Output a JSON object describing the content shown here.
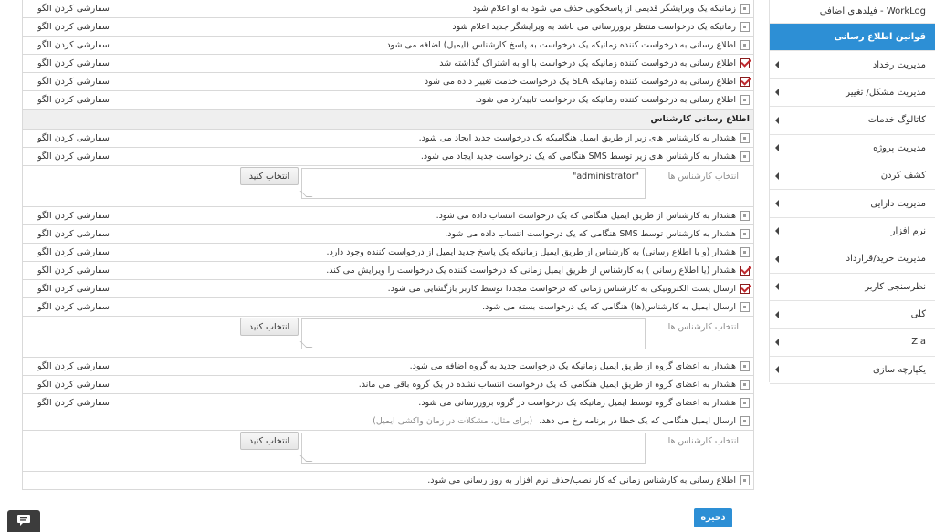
{
  "template_label": "سفارشی کردن الگو",
  "rows_top": [
    {
      "label": "زمانیکه یک ویرایشگر قدیمی از پاسخگویی حذف می شود به او اعلام شود",
      "checked": false
    },
    {
      "label": "زمانیکه یک درخواست منتظر بروزرسانی می باشد به ویرایشگر جدید اعلام شود",
      "checked": false
    },
    {
      "label": "اطلاع رسانی به درخواست کننده زمانیکه یک درخواست به پاسخ کارشناس (ایمیل) اضافه می شود",
      "checked": false
    },
    {
      "label": "اطلاع رسانی به درخواست کننده زمانیکه یک درخواست با او به اشتراک گذاشته شد",
      "checked": true
    },
    {
      "label": "اطلاع رسانی به درخواست کننده زمانیکه SLA یک درخواست خدمت تغییر داده می شود",
      "checked": true
    },
    {
      "label": "اطلاع رسانی به درخواست کننده زمانیکه یک درخواست تایید/رد می شود.",
      "checked": false
    }
  ],
  "section_title": "اطلاع رسانی کارشناس",
  "rows_a": [
    {
      "label": "هشدار به کارشناس های زیر از طریق ایمیل هنگامیکه یک درخواست جدید ایجاد می شود.",
      "checked": false
    },
    {
      "label": "هشدار به کارشناس های زیر توسط SMS هنگامی که یک درخواست جدید ایجاد می شود.",
      "checked": false
    }
  ],
  "picker_label": "انتخاب کارشناس ها",
  "picker_button": "انتخاب کنید",
  "picker1_value": "\"administrator\"",
  "picker2_value": "",
  "picker3_value": "",
  "rows_b": [
    {
      "label": "هشدار به کارشناس از طریق ایمیل هنگامی که یک درخواست انتساب داده می شود.",
      "checked": false
    },
    {
      "label": "هشدار به کارشناس توسط SMS هنگامی که یک درخواست انتساب داده می شود.",
      "checked": false
    },
    {
      "label": "هشدار (و یا اطلاع رسانی) به کارشناس از طریق ایمیل زمانیکه یک پاسخ جدید ایمیل از درخواست کننده وجود دارد.",
      "checked": false
    },
    {
      "label": "هشدار (یا اطلاع رسانی ) به کارشناس از طریق ایمیل زمانی که درخواست کننده یک درخواست را ویرایش می کند.",
      "checked": true
    },
    {
      "label": "ارسال پست الکترونیکی به کارشناس زمانی که درخواست مجددا توسط کاربر بازگشایی می شود.",
      "checked": true
    },
    {
      "label": "ارسال ایمیل به کارشناس(ها) هنگامی که یک درخواست بسته می شود.",
      "checked": false
    }
  ],
  "rows_c": [
    {
      "label": "هشدار به اعضای گروه از طریق ایمیل زمانیکه یک درخواست جدید به گروه اضافه می شود.",
      "checked": false
    },
    {
      "label": "هشدار به اعضای گروه از طریق ایمیل هنگامی که یک درخواست انتساب نشده در یک گروه باقی می ماند.",
      "checked": false
    },
    {
      "label": "هشدار به اعضای گروه توسط ایمیل زمانیکه یک درخواست در گروه بروزرسانی می شود.",
      "checked": false
    }
  ],
  "row_error": {
    "label": "ارسال ایمیل هنگامی که یک خطا در برنامه رخ می دهد.",
    "hint": "(برای مثال، مشکلات در زمان واکشی ایمیل)",
    "checked": false
  },
  "row_last": {
    "label": "اطلاع رسانی به کارشناس زمانی که کار نصب/حذف نرم افزار به روز رسانی می شود.",
    "checked": false
  },
  "save_label": "ذخیره",
  "sidebar": {
    "top": "WorkLog - فیلدهای اضافی",
    "items": [
      {
        "label": "قوانین اطلاع رسانی",
        "active": true,
        "arrow": false
      },
      {
        "label": "مدیریت رخداد",
        "active": false,
        "arrow": true
      },
      {
        "label": "مدیریت مشکل/ تغییر",
        "active": false,
        "arrow": true
      },
      {
        "label": "کاتالوگ خدمات",
        "active": false,
        "arrow": true
      },
      {
        "label": "مدیریت پروژه",
        "active": false,
        "arrow": true
      },
      {
        "label": "کشف کردن",
        "active": false,
        "arrow": true
      },
      {
        "label": "مدیریت دارایی",
        "active": false,
        "arrow": true
      },
      {
        "label": "نرم افزار",
        "active": false,
        "arrow": true
      },
      {
        "label": "مدیریت خرید/قرارداد",
        "active": false,
        "arrow": true
      },
      {
        "label": "نظرسنجی کاربر",
        "active": false,
        "arrow": true
      },
      {
        "label": "کلی",
        "active": false,
        "arrow": true
      },
      {
        "label": "Zia",
        "active": false,
        "arrow": true
      },
      {
        "label": "یکپارچه سازی",
        "active": false,
        "arrow": true
      }
    ]
  },
  "accent_color": "#2d8fd5",
  "check_color": "#c0282d"
}
